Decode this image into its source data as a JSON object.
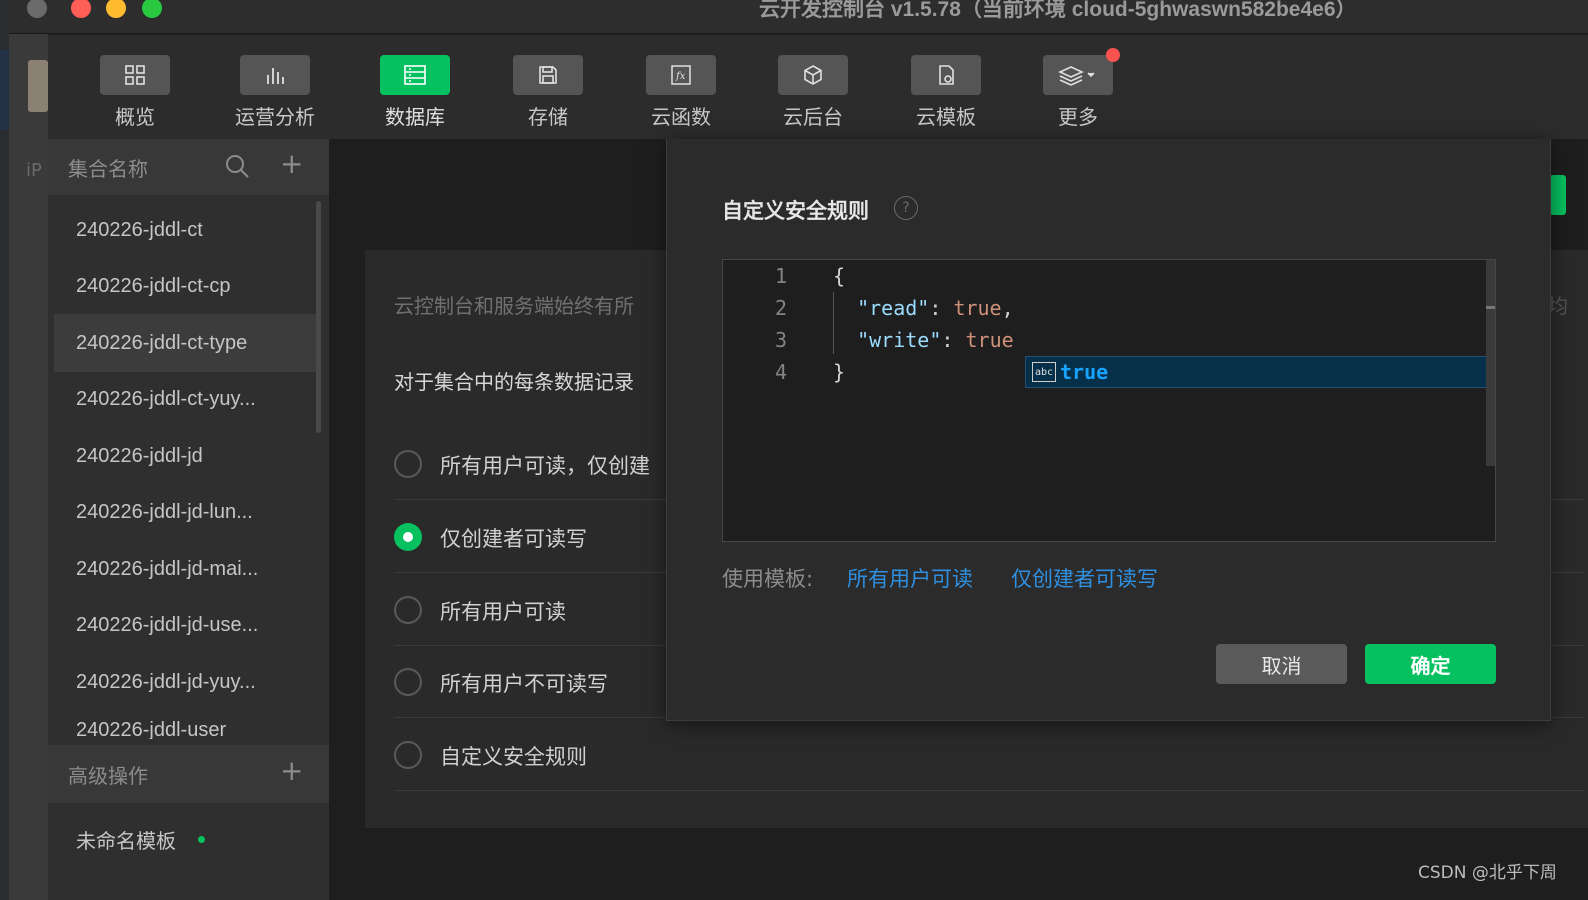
{
  "window": {
    "title": "云开发控制台 v1.5.78（当前环境 cloud-5ghwaswn582be4e6）"
  },
  "background": {
    "left_edge_text": "iP"
  },
  "toolbar": {
    "items": [
      {
        "label": "概览",
        "icon": "grid-icon"
      },
      {
        "label": "运营分析",
        "icon": "bar-chart-icon"
      },
      {
        "label": "数据库",
        "icon": "database-icon"
      },
      {
        "label": "存储",
        "icon": "floppy-disk-icon"
      },
      {
        "label": "云函数",
        "icon": "function-icon"
      },
      {
        "label": "云后台",
        "icon": "cube-icon"
      },
      {
        "label": "云模板",
        "icon": "template-icon"
      },
      {
        "label": "更多",
        "icon": "layers-icon"
      }
    ],
    "active_index": 2
  },
  "sidebar": {
    "header_label": "集合名称",
    "collections": [
      "240226-jddl-ct",
      "240226-jddl-ct-cp",
      "240226-jddl-ct-type",
      "240226-jddl-ct-yuy...",
      "240226-jddl-jd",
      "240226-jddl-jd-lun...",
      "240226-jddl-jd-mai...",
      "240226-jddl-jd-use...",
      "240226-jddl-jd-yuy...",
      "240226-jddl-user"
    ],
    "selected_index": 2,
    "advanced_label": "高级操作",
    "template_item": "未命名模板"
  },
  "main": {
    "description": "云控制台和服务端始终有所",
    "question": "对于集合中的每条数据记录",
    "options": [
      {
        "label": "所有用户可读，仅创建",
        "selected": false
      },
      {
        "label": "仅创建者可读写",
        "selected": true
      },
      {
        "label": "所有用户可读",
        "selected": false
      },
      {
        "label": "所有用户不可读写",
        "selected": false
      },
      {
        "label": "自定义安全规则",
        "selected": false
      }
    ],
    "right_edge_char": "均"
  },
  "modal": {
    "title": "自定义安全规则",
    "help_symbol": "?",
    "editor": {
      "line_numbers": [
        "1",
        "2",
        "3",
        "4"
      ],
      "lines": [
        "{",
        "  \"read\": true,",
        "  \"write\": true",
        "}"
      ],
      "suggestion": {
        "icon_text": "abc",
        "text": "true"
      }
    },
    "template_label": "使用模板:",
    "template_links": [
      "所有用户可读",
      "仅创建者可读写"
    ],
    "cancel_label": "取消",
    "confirm_label": "确定"
  },
  "watermark": "CSDN @北乎下周",
  "colors": {
    "accent": "#07c160",
    "link": "#2f8fe0",
    "danger": "#fa5151"
  }
}
